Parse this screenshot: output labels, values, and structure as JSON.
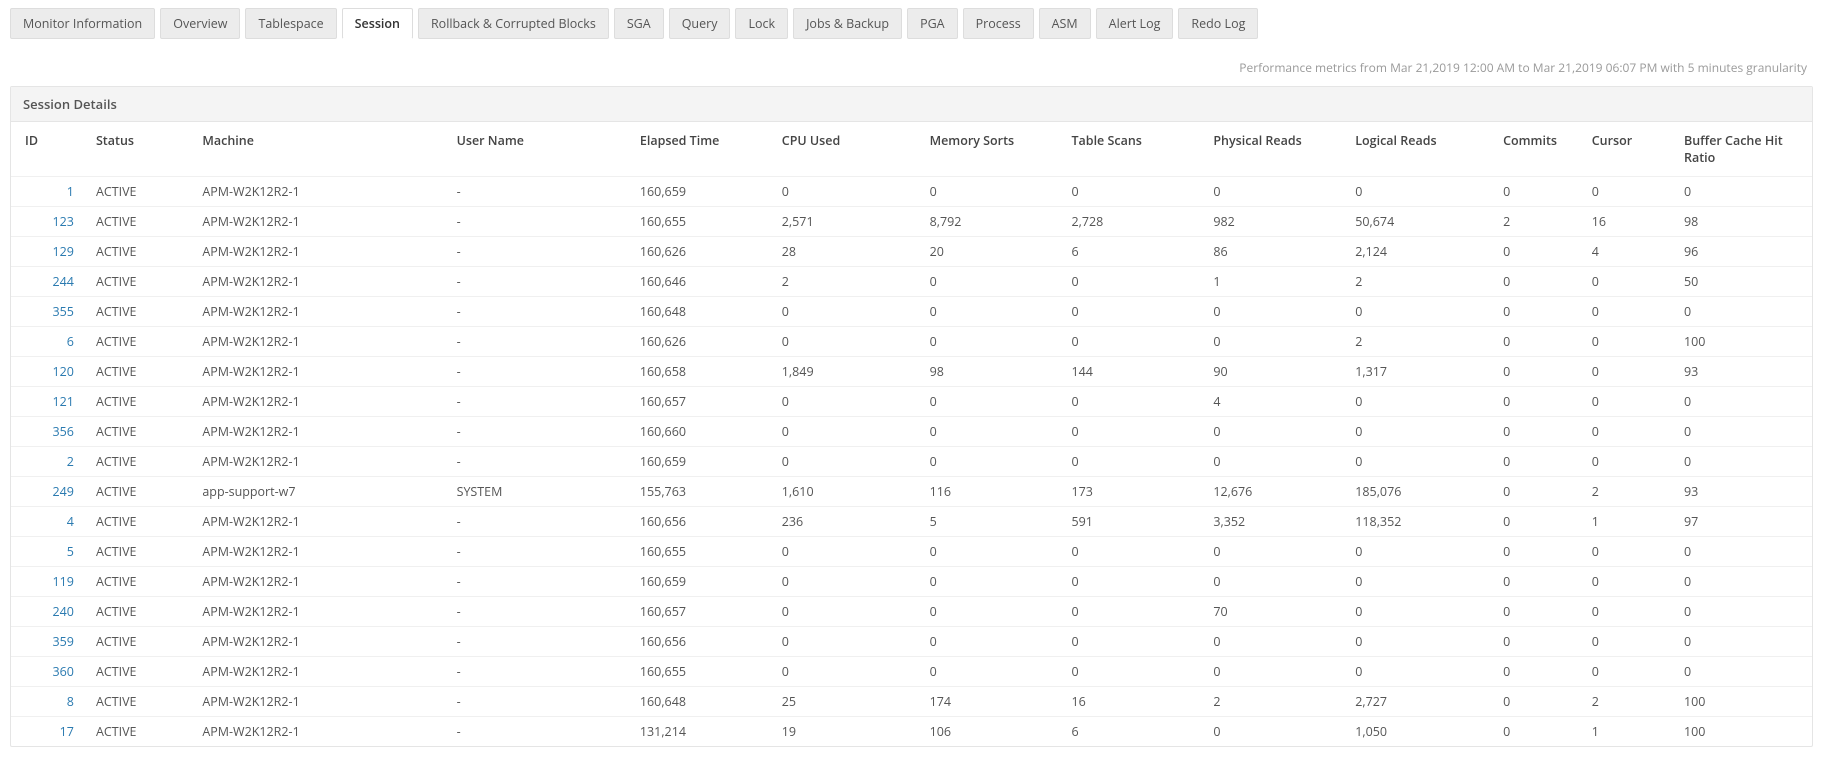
{
  "tabs": [
    {
      "label": "Monitor Information"
    },
    {
      "label": "Overview"
    },
    {
      "label": "Tablespace"
    },
    {
      "label": "Session",
      "active": true
    },
    {
      "label": "Rollback & Corrupted Blocks"
    },
    {
      "label": "SGA"
    },
    {
      "label": "Query"
    },
    {
      "label": "Lock"
    },
    {
      "label": "Jobs & Backup"
    },
    {
      "label": "PGA"
    },
    {
      "label": "Process"
    },
    {
      "label": "ASM"
    },
    {
      "label": "Alert Log"
    },
    {
      "label": "Redo Log"
    }
  ],
  "metrics_line": "Performance metrics from Mar 21,2019 12:00 AM to Mar 21,2019 06:07 PM with 5 minutes granularity",
  "panel": {
    "title": "Session Details",
    "columns": [
      "ID",
      "Status",
      "Machine",
      "User Name",
      "Elapsed Time",
      "CPU Used",
      "Memory Sorts",
      "Table Scans",
      "Physical Reads",
      "Logical Reads",
      "Commits",
      "Cursor",
      "Buffer Cache Hit Ratio"
    ],
    "rows": [
      {
        "id": "1",
        "status": "ACTIVE",
        "machine": "APM-W2K12R2-1",
        "user": "-",
        "elapsed": "160,659",
        "cpu": "0",
        "mem": "0",
        "scan": "0",
        "pread": "0",
        "lread": "0",
        "commit": "0",
        "cursor": "0",
        "buffer": "0"
      },
      {
        "id": "123",
        "status": "ACTIVE",
        "machine": "APM-W2K12R2-1",
        "user": "-",
        "elapsed": "160,655",
        "cpu": "2,571",
        "mem": "8,792",
        "scan": "2,728",
        "pread": "982",
        "lread": "50,674",
        "commit": "2",
        "cursor": "16",
        "buffer": "98"
      },
      {
        "id": "129",
        "status": "ACTIVE",
        "machine": "APM-W2K12R2-1",
        "user": "-",
        "elapsed": "160,626",
        "cpu": "28",
        "mem": "20",
        "scan": "6",
        "pread": "86",
        "lread": "2,124",
        "commit": "0",
        "cursor": "4",
        "buffer": "96"
      },
      {
        "id": "244",
        "status": "ACTIVE",
        "machine": "APM-W2K12R2-1",
        "user": "-",
        "elapsed": "160,646",
        "cpu": "2",
        "mem": "0",
        "scan": "0",
        "pread": "1",
        "lread": "2",
        "commit": "0",
        "cursor": "0",
        "buffer": "50"
      },
      {
        "id": "355",
        "status": "ACTIVE",
        "machine": "APM-W2K12R2-1",
        "user": "-",
        "elapsed": "160,648",
        "cpu": "0",
        "mem": "0",
        "scan": "0",
        "pread": "0",
        "lread": "0",
        "commit": "0",
        "cursor": "0",
        "buffer": "0"
      },
      {
        "id": "6",
        "status": "ACTIVE",
        "machine": "APM-W2K12R2-1",
        "user": "-",
        "elapsed": "160,626",
        "cpu": "0",
        "mem": "0",
        "scan": "0",
        "pread": "0",
        "lread": "2",
        "commit": "0",
        "cursor": "0",
        "buffer": "100"
      },
      {
        "id": "120",
        "status": "ACTIVE",
        "machine": "APM-W2K12R2-1",
        "user": "-",
        "elapsed": "160,658",
        "cpu": "1,849",
        "mem": "98",
        "scan": "144",
        "pread": "90",
        "lread": "1,317",
        "commit": "0",
        "cursor": "0",
        "buffer": "93"
      },
      {
        "id": "121",
        "status": "ACTIVE",
        "machine": "APM-W2K12R2-1",
        "user": "-",
        "elapsed": "160,657",
        "cpu": "0",
        "mem": "0",
        "scan": "0",
        "pread": "4",
        "lread": "0",
        "commit": "0",
        "cursor": "0",
        "buffer": "0"
      },
      {
        "id": "356",
        "status": "ACTIVE",
        "machine": "APM-W2K12R2-1",
        "user": "-",
        "elapsed": "160,660",
        "cpu": "0",
        "mem": "0",
        "scan": "0",
        "pread": "0",
        "lread": "0",
        "commit": "0",
        "cursor": "0",
        "buffer": "0"
      },
      {
        "id": "2",
        "status": "ACTIVE",
        "machine": "APM-W2K12R2-1",
        "user": "-",
        "elapsed": "160,659",
        "cpu": "0",
        "mem": "0",
        "scan": "0",
        "pread": "0",
        "lread": "0",
        "commit": "0",
        "cursor": "0",
        "buffer": "0"
      },
      {
        "id": "249",
        "status": "ACTIVE",
        "machine": "app-support-w7",
        "user": "SYSTEM",
        "elapsed": "155,763",
        "cpu": "1,610",
        "mem": "116",
        "scan": "173",
        "pread": "12,676",
        "lread": "185,076",
        "commit": "0",
        "cursor": "2",
        "buffer": "93"
      },
      {
        "id": "4",
        "status": "ACTIVE",
        "machine": "APM-W2K12R2-1",
        "user": "-",
        "elapsed": "160,656",
        "cpu": "236",
        "mem": "5",
        "scan": "591",
        "pread": "3,352",
        "lread": "118,352",
        "commit": "0",
        "cursor": "1",
        "buffer": "97"
      },
      {
        "id": "5",
        "status": "ACTIVE",
        "machine": "APM-W2K12R2-1",
        "user": "-",
        "elapsed": "160,655",
        "cpu": "0",
        "mem": "0",
        "scan": "0",
        "pread": "0",
        "lread": "0",
        "commit": "0",
        "cursor": "0",
        "buffer": "0"
      },
      {
        "id": "119",
        "status": "ACTIVE",
        "machine": "APM-W2K12R2-1",
        "user": "-",
        "elapsed": "160,659",
        "cpu": "0",
        "mem": "0",
        "scan": "0",
        "pread": "0",
        "lread": "0",
        "commit": "0",
        "cursor": "0",
        "buffer": "0"
      },
      {
        "id": "240",
        "status": "ACTIVE",
        "machine": "APM-W2K12R2-1",
        "user": "-",
        "elapsed": "160,657",
        "cpu": "0",
        "mem": "0",
        "scan": "0",
        "pread": "70",
        "lread": "0",
        "commit": "0",
        "cursor": "0",
        "buffer": "0"
      },
      {
        "id": "359",
        "status": "ACTIVE",
        "machine": "APM-W2K12R2-1",
        "user": "-",
        "elapsed": "160,656",
        "cpu": "0",
        "mem": "0",
        "scan": "0",
        "pread": "0",
        "lread": "0",
        "commit": "0",
        "cursor": "0",
        "buffer": "0"
      },
      {
        "id": "360",
        "status": "ACTIVE",
        "machine": "APM-W2K12R2-1",
        "user": "-",
        "elapsed": "160,655",
        "cpu": "0",
        "mem": "0",
        "scan": "0",
        "pread": "0",
        "lread": "0",
        "commit": "0",
        "cursor": "0",
        "buffer": "0"
      },
      {
        "id": "8",
        "status": "ACTIVE",
        "machine": "APM-W2K12R2-1",
        "user": "-",
        "elapsed": "160,648",
        "cpu": "25",
        "mem": "174",
        "scan": "16",
        "pread": "2",
        "lread": "2,727",
        "commit": "0",
        "cursor": "2",
        "buffer": "100"
      },
      {
        "id": "17",
        "status": "ACTIVE",
        "machine": "APM-W2K12R2-1",
        "user": "-",
        "elapsed": "131,214",
        "cpu": "19",
        "mem": "106",
        "scan": "6",
        "pread": "0",
        "lread": "1,050",
        "commit": "0",
        "cursor": "1",
        "buffer": "100"
      }
    ]
  }
}
